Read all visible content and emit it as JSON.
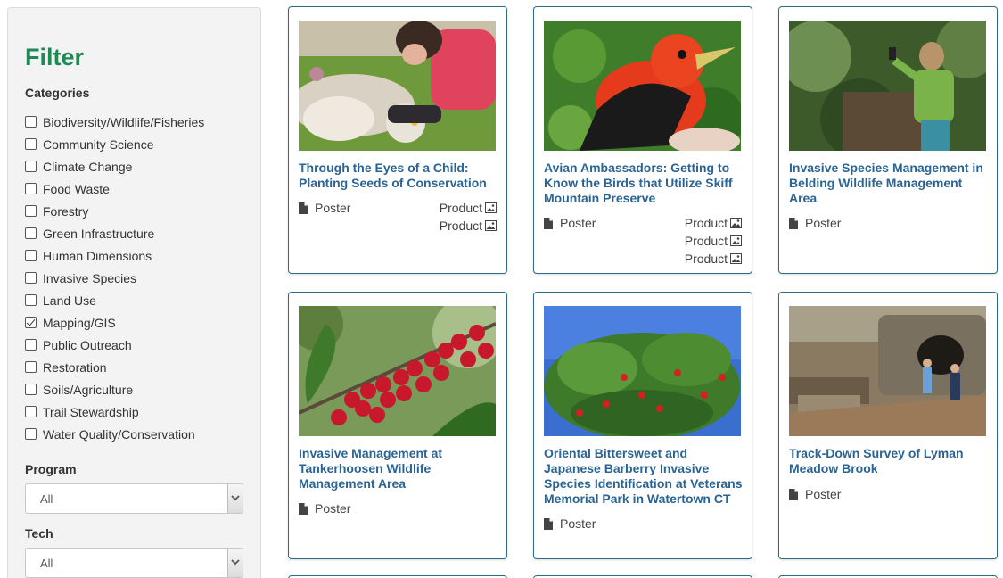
{
  "sidebar": {
    "title": "Filter",
    "categories_label": "Categories",
    "categories": [
      {
        "label": "Biodiversity/Wildlife/Fisheries",
        "checked": false
      },
      {
        "label": "Community Science",
        "checked": false
      },
      {
        "label": "Climate Change",
        "checked": false
      },
      {
        "label": "Food Waste",
        "checked": false
      },
      {
        "label": "Forestry",
        "checked": false
      },
      {
        "label": "Green Infrastructure",
        "checked": false
      },
      {
        "label": "Human Dimensions",
        "checked": false
      },
      {
        "label": "Invasive Species",
        "checked": false
      },
      {
        "label": "Land Use",
        "checked": false
      },
      {
        "label": "Mapping/GIS",
        "checked": true
      },
      {
        "label": "Public Outreach",
        "checked": false
      },
      {
        "label": "Restoration",
        "checked": false
      },
      {
        "label": "Soils/Agriculture",
        "checked": false
      },
      {
        "label": "Trail Stewardship",
        "checked": false
      },
      {
        "label": "Water Quality/Conservation",
        "checked": false
      }
    ],
    "program_label": "Program",
    "program_value": "All",
    "tech_label": "Tech",
    "tech_value": "All"
  },
  "cards": [
    {
      "title": "Through the Eyes of a Child: Planting Seeds of Conservation",
      "type": "Poster",
      "products": [
        "Product",
        "Product"
      ],
      "image": "child-painting-photo"
    },
    {
      "title": "Avian Ambassadors: Getting to Know the Birds that Utilize Skiff Mountain Preserve",
      "type": "Poster",
      "products": [
        "Product",
        "Product",
        "Product"
      ],
      "image": "scarlet-tanager-photo"
    },
    {
      "title": "Invasive Species Management in Belding Wildlife Management Area",
      "type": "Poster",
      "products": [],
      "image": "woman-with-phone-photo"
    },
    {
      "title": "Invasive Management at Tankerhoosen Wildlife Management Area",
      "type": "Poster",
      "products": [],
      "image": "red-berries-photo"
    },
    {
      "title": "Oriental Bittersweet and Japanese Barberry Invasive Species Identification at Veterans Memorial Park in Watertown CT",
      "type": "Poster",
      "products": [],
      "image": "barberry-shrub-photo"
    },
    {
      "title": "Track-Down Survey of Lyman Meadow Brook",
      "type": "Poster",
      "products": [],
      "image": "stone-culvert-photo"
    }
  ],
  "colors": {
    "filter_green": "#1f8a56",
    "title_blue": "#2a6494",
    "card_border": "#2f6b86"
  }
}
